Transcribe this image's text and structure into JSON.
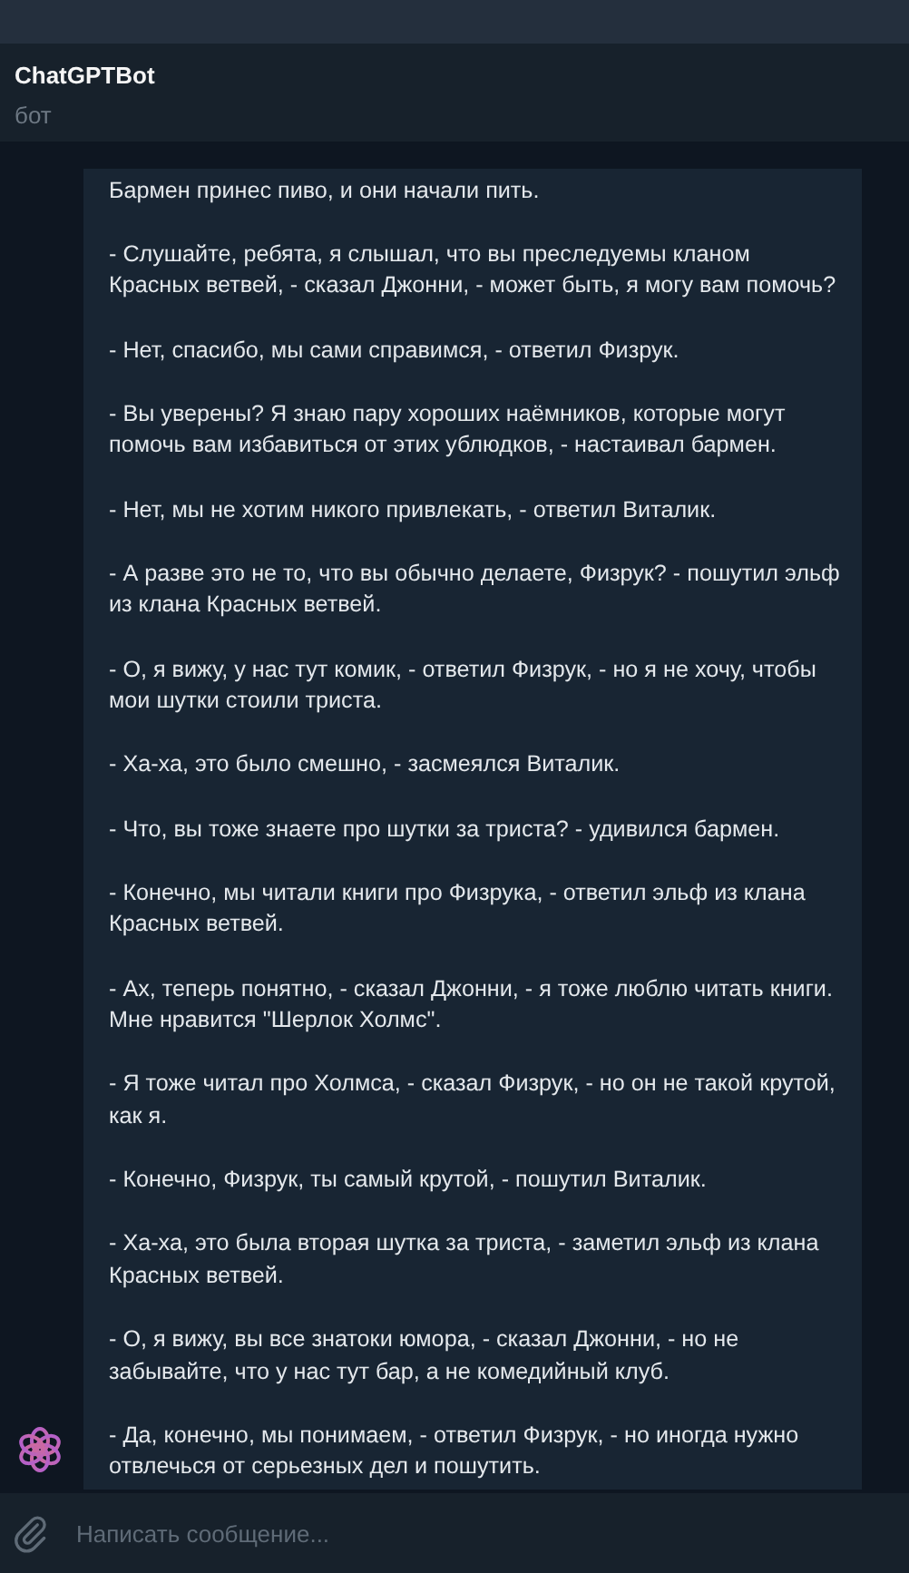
{
  "header": {
    "title": "ChatGPTBot",
    "subtitle": "бот"
  },
  "message": {
    "paragraphs": [
      "Бармен принес пиво, и они начали пить.",
      "- Слушайте, ребята, я слышал, что вы преследуемы кланом Красных ветвей, - сказал Джонни, - может быть, я могу вам помочь?",
      "- Нет, спасибо, мы сами справимся, - ответил Физрук.",
      "- Вы уверены? Я знаю пару хороших наёмников, которые могут помочь вам избавиться от этих ублюдков, - настаивал бармен.",
      "- Нет, мы не хотим никого привлекать, - ответил Виталик.",
      "- А разве это не то, что вы обычно делаете, Физрук? - пошутил эльф из клана Красных ветвей.",
      "- О, я вижу, у нас тут комик, - ответил Физрук, - но я не хочу, чтобы мои шутки стоили триста.",
      "- Ха-ха, это было смешно, - засмеялся Виталик.",
      "- Что, вы тоже знаете про шутки за триста? - удивился бармен.",
      "- Конечно, мы читали книги про Физрука, - ответил эльф из клана Красных ветвей.",
      "- Ах, теперь понятно, - сказал Джонни, - я тоже люблю читать книги. Мне нравится \"Шерлок Холмс\".",
      "- Я тоже читал про Холмса, - сказал Физрук, - но он не такой крутой, как я.",
      "- Конечно, Физрук, ты самый крутой, - пошутил Виталик.",
      "- Ха-ха, это была вторая шутка за триста, - заметил эльф из клана Красных ветвей.",
      "- О, я вижу, вы все знатоки юмора, - сказал Джонни, - но не забывайте, что у нас тут бар, а не комедийный клуб.",
      "- Да, конечно, мы понимаем, - ответил Физрук, - но иногда нужно отвлечься от серьезных дел и пошутить."
    ]
  },
  "composer": {
    "placeholder": "Написать сообщение..."
  }
}
